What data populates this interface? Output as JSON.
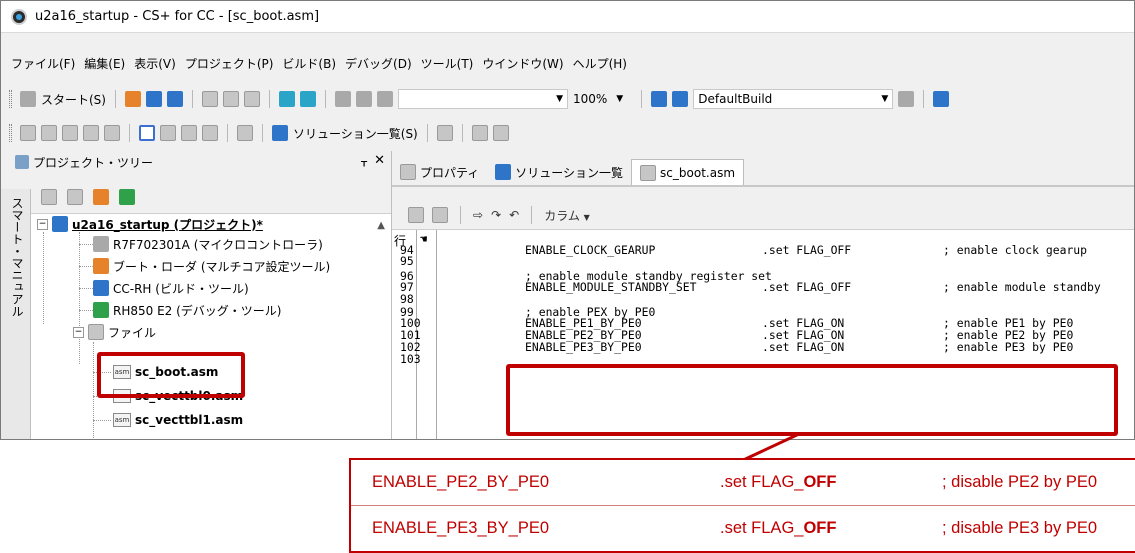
{
  "window": {
    "title": "u2a16_startup - CS+ for CC - [sc_boot.asm]"
  },
  "menu": [
    "ファイル(F)",
    "編集(E)",
    "表示(V)",
    "プロジェクト(P)",
    "ビルド(B)",
    "デバッグ(D)",
    "ツール(T)",
    "ウインドウ(W)",
    "ヘルプ(H)"
  ],
  "toolbar": {
    "start_label": "スタート(S)",
    "zoom": "100%",
    "build_config": "DefaultBuild",
    "solution_list_label": "ソリューション一覧(S)"
  },
  "project_panel": {
    "title": "プロジェクト・ツリー",
    "pin": "ᚁ",
    "close": "✕",
    "side_tab": "スマート・マニュアル",
    "tree": {
      "root": "u2a16_startup (プロジェクト)*",
      "items": [
        "R7F702301A (マイクロコントローラ)",
        "ブート・ローダ (マルチコア設定ツール)",
        "CC-RH (ビルド・ツール)",
        "RH850 E2 (デバッグ・ツール)"
      ],
      "folder": "ファイル",
      "files": [
        "sc_boot.asm",
        "sc_vecttbl0.asm",
        "sc_vecttbl1.asm"
      ]
    }
  },
  "editor": {
    "tabs": [
      {
        "label": "プロパティ",
        "icon": "properties-icon"
      },
      {
        "label": "ソリューション一覧",
        "icon": "solution-icon"
      },
      {
        "label": "sc_boot.asm",
        "icon": "asm-file-icon"
      }
    ],
    "toolbar_columns": "カラム",
    "gutter_header": "行",
    "lines": [
      {
        "n": "94",
        "a": "ENABLE_CLOCK_GEARUP",
        "b": ".set FLAG_OFF",
        "c": "; enable clock gearup"
      },
      {
        "n": "95",
        "a": "",
        "b": "",
        "c": ""
      },
      {
        "n": "96",
        "a": "; enable module standby register set",
        "b": "",
        "c": ""
      },
      {
        "n": "97",
        "a": "ENABLE_MODULE_STANDBY_SET",
        "b": ".set FLAG_OFF",
        "c": "; enable module standby"
      },
      {
        "n": "98",
        "a": "",
        "b": "",
        "c": ""
      },
      {
        "n": "99",
        "a": "; enable PEX by PE0",
        "b": "",
        "c": ""
      },
      {
        "n": "100",
        "a": "ENABLE_PE1_BY_PE0",
        "b": ".set FLAG_ON",
        "c": "; enable PE1 by PE0"
      },
      {
        "n": "101",
        "a": "ENABLE_PE2_BY_PE0",
        "b": ".set FLAG_ON",
        "c": "; enable PE2 by PE0"
      },
      {
        "n": "102",
        "a": "ENABLE_PE3_BY_PE0",
        "b": ".set FLAG_ON",
        "c": "; enable PE3 by PE0"
      },
      {
        "n": "103",
        "a": "",
        "b": "",
        "c": ""
      }
    ]
  },
  "callout": {
    "rows": [
      {
        "key": "ENABLE_PE2_BY_PE0",
        "set_prefix": ".set FLAG_",
        "set_value": "OFF",
        "comment": "; disable PE2 by PE0"
      },
      {
        "key": "ENABLE_PE3_BY_PE0",
        "set_prefix": ".set FLAG_",
        "set_value": "OFF",
        "comment": "; disable PE3 by PE0"
      }
    ]
  },
  "colors": {
    "highlight": "#c00000",
    "accent_blue": "#2e74c9"
  }
}
